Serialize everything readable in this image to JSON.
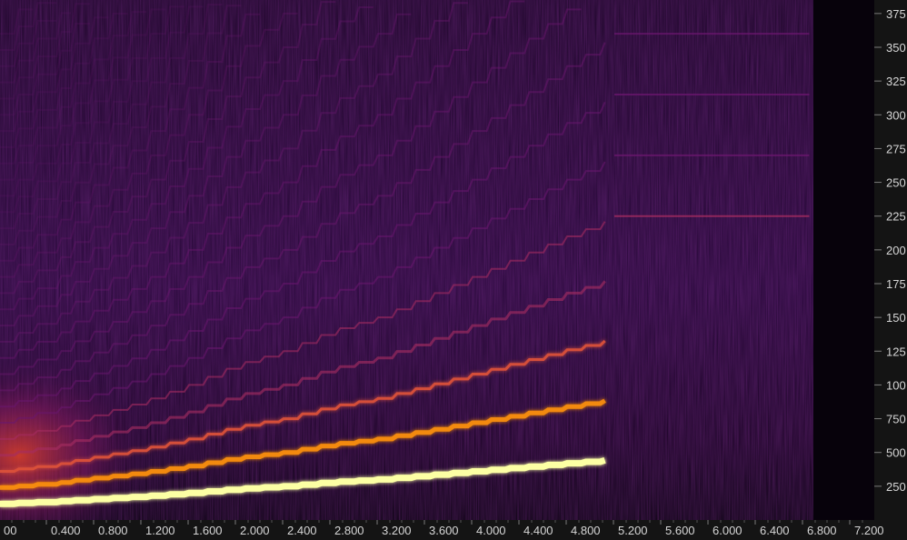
{
  "chart_data": {
    "type": "heatmap",
    "title": "",
    "xlabel": "",
    "ylabel": "",
    "xlim": [
      0,
      7.4
    ],
    "ylim": [
      0,
      3850
    ],
    "x_ticks": [
      "00",
      "0.400",
      "0.800",
      "1.200",
      "1.600",
      "2.000",
      "2.400",
      "2.800",
      "3.200",
      "3.600",
      "4.000",
      "4.400",
      "4.800",
      "5.200",
      "5.600",
      "6.000",
      "6.400",
      "6.800",
      "7.200"
    ],
    "x_tick_values": [
      0.0,
      0.4,
      0.8,
      1.2,
      1.6,
      2.0,
      2.4,
      2.8,
      3.2,
      3.6,
      4.0,
      4.4,
      4.8,
      5.2,
      5.6,
      6.0,
      6.4,
      6.8,
      7.2
    ],
    "y_ticks": [
      "375",
      "350",
      "325",
      "300",
      "275",
      "250",
      "225",
      "200",
      "175",
      "150",
      "125",
      "100",
      "750",
      "500",
      "250"
    ],
    "y_tick_values": [
      3750,
      3500,
      3250,
      3000,
      2750,
      2500,
      2250,
      2000,
      1750,
      1500,
      1250,
      1000,
      750,
      500,
      250
    ],
    "colormap": [
      "#000004",
      "#2a0a4a",
      "#6a176e",
      "#a52c60",
      "#dd513a",
      "#f98e09",
      "#fcffa4"
    ],
    "fundamental": {
      "x": [
        0.0,
        0.4,
        0.8,
        1.2,
        1.6,
        2.0,
        2.4,
        2.8,
        3.2,
        3.6,
        4.0,
        4.4,
        4.8,
        5.1,
        5.2,
        6.8,
        6.9
      ],
      "y": [
        120,
        135,
        155,
        175,
        200,
        230,
        250,
        280,
        300,
        330,
        360,
        390,
        420,
        440,
        450,
        450,
        450
      ]
    },
    "sweep_end_time": 5.15,
    "sustain_end_time": 6.85,
    "sustain_harmonics": [
      1,
      2,
      3,
      4,
      5,
      6,
      7,
      8,
      9,
      10,
      11,
      12,
      13,
      14,
      15,
      16,
      17,
      18,
      19,
      20,
      21,
      22,
      23,
      24,
      25,
      26,
      27,
      28,
      29
    ]
  }
}
